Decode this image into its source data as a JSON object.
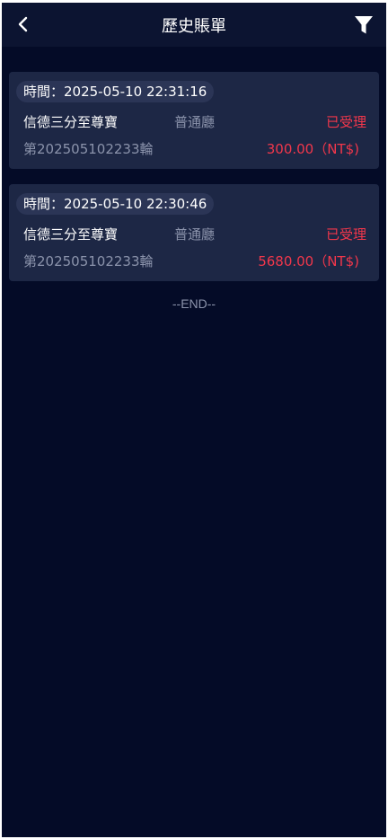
{
  "header": {
    "title": "歷史賬單",
    "back_icon": "chevron-left-icon",
    "filter_icon": "funnel-filter-icon"
  },
  "colors": {
    "background": "#040b27",
    "header": "#0c1431",
    "card": "#1d2745",
    "pill": "#2b3556",
    "accent_red": "#f2374b",
    "muted": "#8b93ab"
  },
  "records": [
    {
      "time": "時間：2025-05-10 22:31:16",
      "game": "信德三分至尊寶",
      "hall": "普通廳",
      "status": "已受理",
      "round": "第202505102233輪",
      "amount": "300.00（NT$)"
    },
    {
      "time": "時間：2025-05-10 22:30:46",
      "game": "信德三分至尊寶",
      "hall": "普通廳",
      "status": "已受理",
      "round": "第202505102233輪",
      "amount": "5680.00（NT$)"
    }
  ],
  "footer": {
    "end_text": "--END--"
  }
}
